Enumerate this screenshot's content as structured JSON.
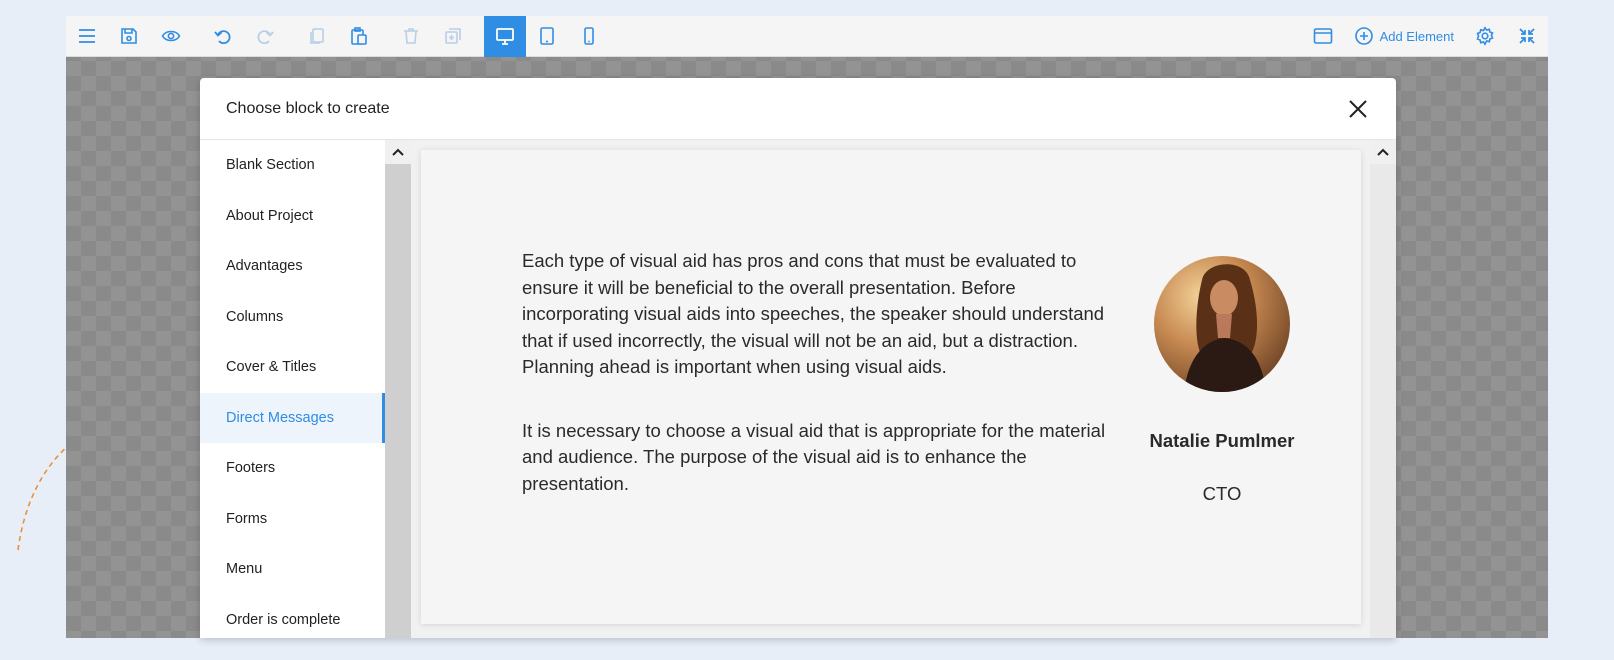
{
  "toolbar": {
    "add_element_label": "Add Element"
  },
  "modal": {
    "title": "Choose block to create",
    "categories": [
      "Blank Section",
      "About Project",
      "Advantages",
      "Columns",
      "Cover & Titles",
      "Direct Messages",
      "Footers",
      "Forms",
      "Menu",
      "Order is complete"
    ],
    "active_category": "Direct Messages"
  },
  "preview": {
    "paragraph1": "Each type of visual aid has pros and cons that must be evaluated to ensure it will be beneficial to the overall presentation. Before incorporating visual aids into speeches, the speaker should understand that if used incorrectly, the visual will not be an aid, but a distraction. Planning ahead is important when using visual aids.",
    "paragraph2": "It is necessary to choose a visual aid that is appropriate for the material and audience. The purpose of the visual aid is to enhance the presentation.",
    "person_name": "Natalie Pumlmer",
    "person_role": "CTO"
  },
  "colors": {
    "accent": "#2f8de4",
    "deco_arrow": "#e8913a"
  },
  "icons": {
    "toolbar": [
      "menu-icon",
      "save-icon",
      "preview-eye-icon",
      "undo-icon",
      "redo-icon",
      "copy-icon",
      "paste-icon",
      "delete-icon",
      "duplicate-icon",
      "desktop-icon",
      "tablet-icon",
      "mobile-icon",
      "browser-window-icon",
      "add-circle-icon",
      "settings-gear-icon",
      "collapse-icon"
    ]
  }
}
